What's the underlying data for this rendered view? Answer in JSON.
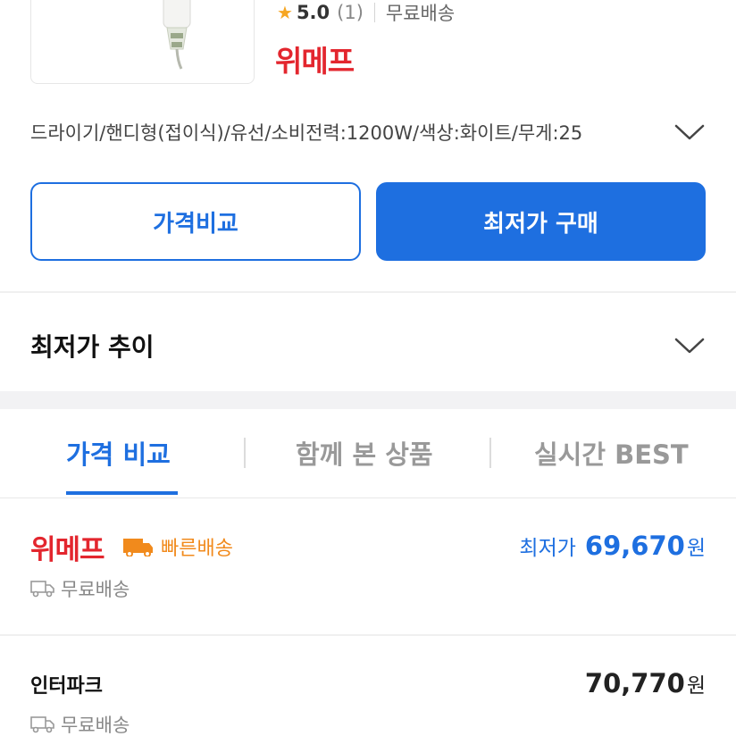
{
  "product": {
    "rating_value": "5.0",
    "rating_count": "(1)",
    "shipping": "무료배송",
    "brand": "위메프",
    "specs": "드라이기/핸디형(접이식)/유선/소비전력:1200W/색상:화이트/무게:25"
  },
  "actions": {
    "compare_label": "가격비교",
    "buy_label": "최저가 구매"
  },
  "trend": {
    "title": "최저가 추이"
  },
  "tabs": [
    {
      "label": "가격 비교"
    },
    {
      "label": "함께 본 상품"
    },
    {
      "label": "실시간 BEST"
    }
  ],
  "sellers": [
    {
      "name": "위메프",
      "badge": "빠른배송",
      "shipping": "무료배송",
      "price_label": "최저가",
      "price": "69,670",
      "unit": "원"
    },
    {
      "name": "인터파크",
      "shipping": "무료배송",
      "price": "70,770",
      "unit": "원"
    }
  ],
  "colors": {
    "accent": "#1e6fe0",
    "brand_red": "#e3262e",
    "fast_orange": "#f18a1c",
    "star": "#f6a623"
  }
}
